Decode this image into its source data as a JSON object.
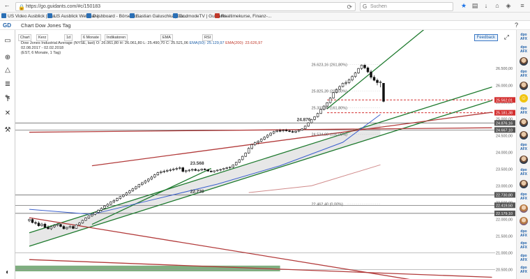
{
  "browser": {
    "url": "https://go.guidants.com/#c/150183",
    "search_placeholder": "Suchen",
    "bookmarks": [
      {
        "label": "US Video Ausblick | Gu...",
        "color": "#2a6fb5"
      },
      {
        "label": "US Ausblick Webinar | ...",
        "color": "#2a6fb5"
      },
      {
        "label": "Dashboard - BörseGo ...",
        "color": "#2a6fb5"
      },
      {
        "label": "Bastian Galuschka | Gu...",
        "color": "#2a6fb5"
      },
      {
        "label": "GodmodeTV | Guidants",
        "color": "#2a6fb5"
      },
      {
        "label": "Realtimekurse, Finanz-...",
        "color": "#c0392b"
      }
    ]
  },
  "app": {
    "title": "Chart Dow Jones Tag"
  },
  "toolbar": {
    "buttons": [
      "Chart",
      "Kerz",
      "1d",
      "6 Monate",
      "Indikatoren",
      "EMA",
      "RSI"
    ],
    "feedback": "Feedback"
  },
  "info": {
    "line1": "Dow Jones Industrial Average (NYSE, last)  O: 26.061,80  H: 26.061,80  L: 25.490,70  C: 25.521,06",
    "ema50": "EMA(50): 25.129,97",
    "ema200": "EMA(200): 23.626,97",
    "line2": "02.08.2017 - 02.02.2018",
    "line3": "(EST, 6 Monate, 1 Tag)"
  },
  "chart_data": {
    "type": "candlestick",
    "title": "Dow Jones Industrial Average",
    "ylim": [
      20450,
      26900
    ],
    "y_ticks": [
      "26.500,00",
      "26.000,00",
      "25.500,00",
      "25.000,00",
      "24.500,00",
      "24.000,00",
      "23.500,00",
      "23.000,00",
      "22.500,00",
      "22.000,00",
      "21.500,00",
      "21.000,00",
      "20.500,00"
    ],
    "price_tags": [
      {
        "label": "25.562,01",
        "value": 25562,
        "color": "#d32f2f"
      },
      {
        "label": "25.181,38",
        "value": 25181,
        "color": "#d32f2f"
      },
      {
        "label": "24.876,16",
        "value": 24876,
        "color": "#555555"
      },
      {
        "label": "24.667,10",
        "value": 24667,
        "color": "#555555"
      },
      {
        "label": "22.730,80",
        "value": 22731,
        "color": "#555555"
      },
      {
        "label": "22.419,50",
        "value": 22420,
        "color": "#555555"
      },
      {
        "label": "22.179,10",
        "value": 22179,
        "color": "#555555"
      }
    ],
    "fib_labels": [
      {
        "label": "26.623,16 (261,80%)",
        "value": 26623
      },
      {
        "label": "25.825,39 (200,00%)",
        "value": 25825
      },
      {
        "label": "25.331,98 (161,80%)",
        "value": 25332
      },
      {
        "label": "24.534,00 (100,00%)",
        "value": 24534
      },
      {
        "label": "22.462,40 (0,00%)",
        "value": 22462
      }
    ],
    "annotations": [
      {
        "label": "24.876",
        "value": 24876
      },
      {
        "label": "23.568",
        "value": 23568
      },
      {
        "label": "22.730",
        "value": 22730
      }
    ],
    "candles": [
      [
        21963,
        22020,
        21920,
        21998
      ],
      [
        21998,
        22040,
        21880,
        21905
      ],
      [
        21905,
        21960,
        21840,
        21890
      ],
      [
        21890,
        21940,
        21780,
        21810
      ],
      [
        21810,
        21900,
        21780,
        21860
      ],
      [
        21860,
        21900,
        21740,
        21760
      ],
      [
        21760,
        21820,
        21700,
        21720
      ],
      [
        21720,
        21800,
        21680,
        21780
      ],
      [
        21780,
        21860,
        21740,
        21820
      ],
      [
        21820,
        21880,
        21790,
        21850
      ],
      [
        21850,
        21870,
        21760,
        21790
      ],
      [
        21790,
        21830,
        21700,
        21720
      ],
      [
        21720,
        21780,
        21690,
        21760
      ],
      [
        21760,
        21820,
        21730,
        21790
      ],
      [
        21790,
        21820,
        21710,
        21730
      ],
      [
        21730,
        21860,
        21720,
        21840
      ],
      [
        21840,
        21920,
        21820,
        21890
      ],
      [
        21890,
        21990,
        21870,
        21970
      ],
      [
        21970,
        22060,
        21950,
        22040
      ],
      [
        22040,
        22120,
        22010,
        22100
      ],
      [
        22100,
        22180,
        22070,
        22150
      ],
      [
        22150,
        22230,
        22120,
        22210
      ],
      [
        22210,
        22300,
        22190,
        22270
      ],
      [
        22270,
        22360,
        22240,
        22330
      ],
      [
        22330,
        22420,
        22300,
        22400
      ],
      [
        22400,
        22480,
        22370,
        22450
      ],
      [
        22450,
        22540,
        22420,
        22520
      ],
      [
        22520,
        22600,
        22480,
        22560
      ],
      [
        22560,
        22650,
        22530,
        22620
      ],
      [
        22620,
        22700,
        22590,
        22680
      ],
      [
        22680,
        22760,
        22650,
        22730
      ],
      [
        22730,
        22820,
        22700,
        22790
      ],
      [
        22790,
        22880,
        22760,
        22850
      ],
      [
        22850,
        22940,
        22820,
        22910
      ],
      [
        22910,
        23000,
        22880,
        22970
      ],
      [
        22970,
        23060,
        22940,
        23040
      ],
      [
        23040,
        23120,
        23000,
        23090
      ],
      [
        23090,
        23180,
        23060,
        23150
      ],
      [
        23150,
        23230,
        23100,
        23200
      ],
      [
        23200,
        23300,
        23170,
        23260
      ],
      [
        23260,
        23360,
        23230,
        23330
      ],
      [
        23330,
        23420,
        23300,
        23390
      ],
      [
        23390,
        23460,
        23350,
        23420
      ],
      [
        23420,
        23480,
        23380,
        23440
      ],
      [
        23440,
        23500,
        23400,
        23460
      ],
      [
        23460,
        23520,
        23420,
        23480
      ],
      [
        23480,
        23540,
        23440,
        23500
      ],
      [
        23500,
        23560,
        23460,
        23520
      ],
      [
        23520,
        23580,
        23480,
        23540
      ],
      [
        23540,
        23568,
        23400,
        23430
      ],
      [
        23430,
        23480,
        23380,
        23450
      ],
      [
        23450,
        23500,
        23410,
        23470
      ],
      [
        23470,
        23520,
        23430,
        23490
      ],
      [
        23490,
        23530,
        23440,
        23460
      ],
      [
        23460,
        23500,
        23420,
        23470
      ],
      [
        23470,
        23520,
        23440,
        23500
      ],
      [
        23500,
        23530,
        23460,
        23480
      ],
      [
        23480,
        23510,
        23420,
        23440
      ],
      [
        23440,
        23480,
        23400,
        23420
      ],
      [
        23420,
        23460,
        23390,
        23450
      ],
      [
        23450,
        23490,
        23420,
        23470
      ],
      [
        23470,
        23510,
        23430,
        23490
      ],
      [
        23490,
        23540,
        23460,
        23520
      ],
      [
        23520,
        23570,
        23490,
        23540
      ],
      [
        23540,
        23580,
        23500,
        23560
      ],
      [
        23560,
        23640,
        23530,
        23620
      ],
      [
        23620,
        23720,
        23600,
        23700
      ],
      [
        23700,
        23800,
        23680,
        23780
      ],
      [
        23780,
        23900,
        23760,
        23880
      ],
      [
        23880,
        24000,
        23860,
        23980
      ],
      [
        23980,
        24150,
        23960,
        24120
      ],
      [
        24120,
        24260,
        24080,
        24230
      ],
      [
        24230,
        24320,
        24190,
        24290
      ],
      [
        24290,
        24360,
        24240,
        24330
      ],
      [
        24330,
        24420,
        24300,
        24390
      ],
      [
        24390,
        24480,
        24360,
        24450
      ],
      [
        24450,
        24540,
        24420,
        24510
      ],
      [
        24510,
        24600,
        24480,
        24570
      ],
      [
        24570,
        24640,
        24540,
        24620
      ],
      [
        24620,
        24680,
        24590,
        24650
      ],
      [
        24650,
        24700,
        24600,
        24640
      ],
      [
        24640,
        24690,
        24600,
        24660
      ],
      [
        24660,
        24700,
        24620,
        24640
      ],
      [
        24640,
        24680,
        24600,
        24620
      ],
      [
        24620,
        24660,
        24580,
        24600
      ],
      [
        24600,
        24650,
        24570,
        24630
      ],
      [
        24630,
        24680,
        24600,
        24660
      ],
      [
        24660,
        24720,
        24640,
        24700
      ],
      [
        24700,
        24800,
        24680,
        24780
      ],
      [
        24780,
        24900,
        24760,
        24880
      ],
      [
        24880,
        25000,
        24860,
        24980
      ],
      [
        24980,
        25080,
        24950,
        25060
      ],
      [
        25060,
        25180,
        25040,
        25160
      ],
      [
        25160,
        25300,
        25140,
        25280
      ],
      [
        25280,
        25400,
        25250,
        25380
      ],
      [
        25380,
        25500,
        25350,
        25480
      ],
      [
        25480,
        25650,
        25460,
        25620
      ],
      [
        25620,
        25800,
        25600,
        25780
      ],
      [
        25780,
        25900,
        25760,
        25880
      ],
      [
        25880,
        26000,
        25860,
        25960
      ],
      [
        25960,
        26080,
        25940,
        26060
      ],
      [
        26060,
        26140,
        26000,
        26080
      ],
      [
        26080,
        26200,
        26040,
        26160
      ],
      [
        26160,
        26300,
        26120,
        26260
      ],
      [
        26260,
        26400,
        26220,
        26370
      ],
      [
        26370,
        26520,
        26340,
        26500
      ],
      [
        26500,
        26620,
        26460,
        26600
      ],
      [
        26600,
        26640,
        26480,
        26520
      ],
      [
        26520,
        26560,
        26360,
        26400
      ],
      [
        26400,
        26460,
        26180,
        26240
      ],
      [
        26240,
        26300,
        26120,
        26150
      ],
      [
        26150,
        26200,
        26000,
        26080
      ],
      [
        26080,
        26140,
        25940,
        26100
      ],
      [
        26061,
        26061,
        25490,
        25521
      ]
    ],
    "ema50": [
      [
        0,
        22300
      ],
      [
        20,
        22150
      ],
      [
        40,
        22600
      ],
      [
        60,
        23050
      ],
      [
        80,
        23600
      ],
      [
        100,
        24300
      ],
      [
        112,
        25130
      ]
    ],
    "ema200": [
      [
        70,
        22800
      ],
      [
        90,
        23000
      ],
      [
        112,
        23627
      ]
    ],
    "trendlines": [
      {
        "color": "#1e7a2e",
        "from": [
          0,
          21600
        ],
        "to": [
          112,
          24900
        ]
      },
      {
        "color": "#1e7a2e",
        "from": [
          0,
          21200
        ],
        "to": [
          112,
          24500
        ]
      },
      {
        "color": "#1e7a2e",
        "from": [
          20,
          21850
        ],
        "to": [
          58,
          23520
        ]
      },
      {
        "color": "#1e7a2e",
        "from": [
          95,
          25300
        ],
        "to": [
          112,
          26600
        ]
      },
      {
        "color": "#b23a3a",
        "from": [
          0,
          24600
        ],
        "to": [
          112,
          24700
        ]
      },
      {
        "color": "#b23a3a",
        "from": [
          0,
          22050
        ],
        "to": [
          112,
          20350
        ]
      },
      {
        "color": "#b23a3a",
        "from": [
          0,
          20800
        ],
        "to": [
          112,
          20400
        ]
      },
      {
        "color": "#b23a3a",
        "from": [
          20,
          23600
        ],
        "to": [
          112,
          24750
        ]
      }
    ]
  },
  "right_sidebar": {
    "items": [
      {
        "kind": "badge",
        "label": "dpo AFX"
      },
      {
        "kind": "badge",
        "label": "dpo AFX"
      },
      {
        "kind": "avatar",
        "label": ""
      },
      {
        "kind": "badge",
        "label": "dpo AFX"
      },
      {
        "kind": "avatar",
        "label": ""
      },
      {
        "kind": "yellow",
        "label": "☺"
      },
      {
        "kind": "badge",
        "label": "dpo AFX"
      },
      {
        "kind": "avatar",
        "label": ""
      },
      {
        "kind": "avatar",
        "label": ""
      },
      {
        "kind": "badge",
        "label": "dpo AFX"
      },
      {
        "kind": "avatar",
        "label": ""
      },
      {
        "kind": "badge",
        "label": "dpo AFX"
      },
      {
        "kind": "avatar",
        "label": ""
      },
      {
        "kind": "badge",
        "label": "dpo AFX"
      },
      {
        "kind": "avatar",
        "label": ""
      },
      {
        "kind": "avatar",
        "label": ""
      },
      {
        "kind": "badge",
        "label": "dpo AFX"
      },
      {
        "kind": "badge",
        "label": "dpo AFX"
      },
      {
        "kind": "badge",
        "label": "dpo AFX"
      },
      {
        "kind": "badge",
        "label": "dpo AFX"
      }
    ]
  }
}
